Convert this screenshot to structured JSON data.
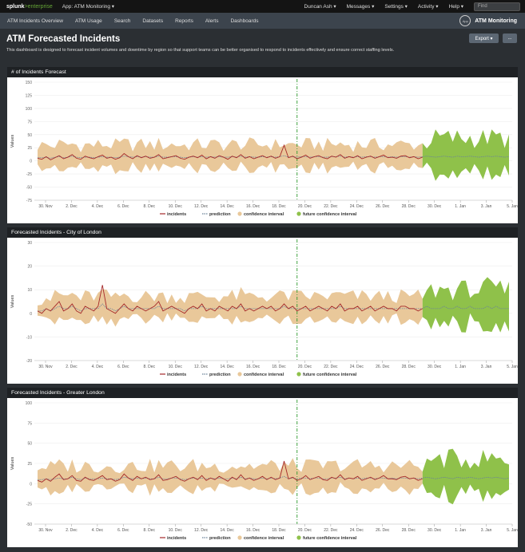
{
  "topbar": {
    "logo_a": "splunk",
    "logo_b": ">enterprise",
    "app_menu": "App: ATM Monitoring ▾",
    "menus": [
      "Duncan Ash ▾",
      "Messages ▾",
      "Settings ▾",
      "Activity ▾",
      "Help ▾"
    ],
    "find_placeholder": "Find"
  },
  "nav": {
    "items": [
      "ATM Incidents Overview",
      "ATM Usage",
      "Search",
      "Datasets",
      "Reports",
      "Alerts",
      "Dashboards"
    ],
    "app_icon_text": "App",
    "brand": "ATM Monitoring"
  },
  "page": {
    "title": "ATM Forecasted Incidents",
    "description": "This dashboard is designed to forecast incident volumes and downtime by region so that support teams can be better organised to respond to incidents effectively and ensure correct staffing levels.",
    "export_label": "Export ▾",
    "more_label": "..."
  },
  "legend": [
    "incidents",
    "prediction",
    "confidence interval",
    "future confidence interval"
  ],
  "colors": {
    "incidents": "#a5292a",
    "prediction": "#6b8299",
    "confidence": "#e9c89a",
    "future": "#8fc14a",
    "divider": "#2e9a2e"
  },
  "chart_data": [
    {
      "type": "area",
      "title": "# of Incidents Forecast",
      "ylabel": "Values",
      "ylim": [
        -75,
        150
      ],
      "yticks": [
        "150",
        "125",
        "100",
        "75",
        "50",
        "25",
        "0",
        "-25",
        "-50",
        "-75"
      ],
      "xticks": [
        "30. Nov",
        "2. Dec",
        "4. Dec",
        "6. Dec",
        "8. Dec",
        "10. Dec",
        "12. Dec",
        "14. Dec",
        "16. Dec",
        "18. Dec",
        "20. Dec",
        "22. Dec",
        "24. Dec",
        "26. Dec",
        "28. Dec",
        "30. Dec",
        "1. Jan",
        "3. Jan",
        "5. Jan"
      ],
      "series": [
        {
          "name": "incidents",
          "values": [
            5,
            3,
            8,
            2,
            6,
            10,
            4,
            7,
            12,
            5,
            3,
            9,
            6,
            4,
            8,
            11,
            5,
            7,
            3,
            6,
            14,
            8,
            4,
            10,
            6,
            9,
            5,
            7,
            12,
            4,
            6,
            8,
            10,
            5,
            3,
            7,
            9,
            6,
            11,
            4,
            8,
            5,
            10,
            7,
            3,
            9,
            6,
            12,
            5,
            8,
            4,
            7,
            10,
            6,
            9,
            5,
            8,
            30,
            6,
            9,
            4,
            7,
            11,
            5,
            8,
            10,
            6,
            4,
            9,
            7,
            12,
            5,
            8,
            6,
            10,
            4,
            7,
            9,
            5,
            8,
            11,
            6,
            7,
            5,
            9,
            10,
            6,
            8,
            4,
            7
          ]
        },
        {
          "name": "prediction",
          "values": [
            6,
            6,
            7,
            5,
            7,
            8,
            6,
            7,
            9,
            7,
            6,
            7,
            7,
            6,
            7,
            8,
            7,
            7,
            6,
            7,
            9,
            8,
            7,
            8,
            7,
            8,
            7,
            7,
            9,
            7,
            7,
            8,
            8,
            7,
            6,
            7,
            8,
            7,
            8,
            7,
            8,
            7,
            8,
            7,
            7,
            8,
            7,
            9,
            7,
            8,
            7,
            7,
            8,
            7,
            8,
            7,
            8,
            10,
            7,
            8,
            7,
            8,
            8,
            7,
            8,
            8,
            7,
            7,
            8,
            8,
            9,
            7,
            8,
            7,
            8,
            7,
            8,
            8,
            7,
            8,
            8,
            7,
            8,
            7,
            8,
            8,
            7,
            8,
            7,
            8,
            9,
            8,
            7,
            8,
            9,
            8,
            7,
            9,
            8,
            8,
            9,
            8,
            7,
            8,
            9,
            8,
            9,
            8,
            7,
            8
          ]
        }
      ]
    },
    {
      "type": "area",
      "title": "Forecasted Incidents - City of London",
      "ylabel": "Values",
      "ylim": [
        -20,
        30
      ],
      "yticks": [
        "30",
        "20",
        "10",
        "0",
        "-10",
        "-20"
      ],
      "xticks": [
        "30. Nov",
        "2. Dec",
        "4. Dec",
        "6. Dec",
        "8. Dec",
        "10. Dec",
        "12. Dec",
        "14. Dec",
        "16. Dec",
        "18. Dec",
        "20. Dec",
        "22. Dec",
        "24. Dec",
        "26. Dec",
        "28. Dec",
        "30. Dec",
        "1. Jan",
        "3. Jan",
        "5. Jan"
      ],
      "series": [
        {
          "name": "incidents",
          "values": [
            1,
            0,
            2,
            1,
            3,
            5,
            1,
            2,
            4,
            1,
            0,
            3,
            2,
            1,
            3,
            12,
            2,
            1,
            0,
            2,
            4,
            2,
            1,
            3,
            2,
            1,
            2,
            3,
            5,
            1,
            2,
            3,
            2,
            1,
            0,
            2,
            3,
            2,
            4,
            1,
            2,
            1,
            3,
            2,
            1,
            3,
            2,
            4,
            1,
            2,
            1,
            2,
            3,
            2,
            3,
            1,
            2,
            4,
            2,
            3,
            1,
            2,
            3,
            1,
            2,
            3,
            2,
            1,
            3,
            2,
            4,
            1,
            2,
            2,
            3,
            1,
            2,
            3,
            1,
            2,
            3,
            2,
            2,
            1,
            3,
            3,
            2,
            2,
            1,
            2
          ]
        },
        {
          "name": "prediction",
          "values": [
            1,
            1,
            2,
            1,
            2,
            3,
            2,
            2,
            3,
            2,
            1,
            2,
            2,
            2,
            2,
            4,
            2,
            2,
            1,
            2,
            3,
            2,
            2,
            2,
            2,
            2,
            2,
            2,
            3,
            2,
            2,
            2,
            2,
            2,
            1,
            2,
            2,
            2,
            3,
            2,
            2,
            2,
            2,
            2,
            2,
            2,
            2,
            3,
            2,
            2,
            2,
            2,
            2,
            2,
            2,
            2,
            2,
            3,
            2,
            2,
            2,
            2,
            2,
            2,
            2,
            2,
            2,
            2,
            2,
            2,
            3,
            2,
            2,
            2,
            2,
            2,
            2,
            2,
            2,
            2,
            2,
            2,
            2,
            2,
            2,
            2,
            2,
            2,
            2,
            2,
            3,
            2,
            2,
            2,
            3,
            2,
            2,
            3,
            2,
            2,
            3,
            2,
            2,
            2,
            3,
            2,
            3,
            2,
            2,
            2
          ]
        }
      ]
    },
    {
      "type": "area",
      "title": "Forecasted Incidents - Greater London",
      "ylabel": "Values",
      "ylim": [
        -50,
        100
      ],
      "yticks": [
        "100",
        "75",
        "50",
        "25",
        "0",
        "-25",
        "-50"
      ],
      "xticks": [
        "30. Nov",
        "2. Dec",
        "4. Dec",
        "6. Dec",
        "8. Dec",
        "10. Dec",
        "12. Dec",
        "14. Dec",
        "16. Dec",
        "18. Dec",
        "20. Dec",
        "22. Dec",
        "24. Dec",
        "26. Dec",
        "28. Dec",
        "30. Dec",
        "1. Jan",
        "3. Jan",
        "5. Jan"
      ],
      "series": [
        {
          "name": "incidents",
          "values": [
            4,
            2,
            6,
            3,
            8,
            12,
            5,
            6,
            10,
            4,
            3,
            8,
            5,
            4,
            7,
            10,
            5,
            6,
            3,
            5,
            12,
            7,
            4,
            9,
            6,
            8,
            5,
            6,
            11,
            4,
            5,
            7,
            9,
            5,
            3,
            6,
            8,
            5,
            10,
            4,
            7,
            5,
            9,
            6,
            3,
            8,
            5,
            11,
            5,
            7,
            4,
            6,
            9,
            5,
            8,
            5,
            7,
            28,
            6,
            8,
            4,
            6,
            10,
            5,
            7,
            9,
            5,
            4,
            8,
            6,
            11,
            5,
            7,
            6,
            9,
            4,
            6,
            8,
            5,
            7,
            10,
            6,
            6,
            5,
            8,
            9,
            6,
            7,
            4,
            6
          ]
        },
        {
          "name": "prediction",
          "values": [
            5,
            5,
            6,
            5,
            6,
            7,
            6,
            6,
            8,
            6,
            5,
            7,
            6,
            6,
            6,
            7,
            6,
            6,
            5,
            6,
            8,
            7,
            6,
            7,
            6,
            7,
            6,
            6,
            8,
            6,
            6,
            7,
            7,
            6,
            5,
            6,
            7,
            6,
            7,
            6,
            7,
            6,
            7,
            6,
            6,
            7,
            6,
            8,
            6,
            7,
            6,
            6,
            7,
            6,
            7,
            6,
            7,
            9,
            6,
            7,
            6,
            7,
            7,
            6,
            7,
            7,
            6,
            6,
            7,
            7,
            8,
            6,
            7,
            6,
            7,
            6,
            7,
            7,
            6,
            7,
            7,
            6,
            7,
            6,
            7,
            7,
            6,
            7,
            6,
            7,
            8,
            7,
            6,
            7,
            8,
            7,
            6,
            8,
            7,
            7,
            8,
            7,
            6,
            7,
            8,
            7,
            8,
            7,
            6,
            7
          ]
        }
      ]
    }
  ]
}
